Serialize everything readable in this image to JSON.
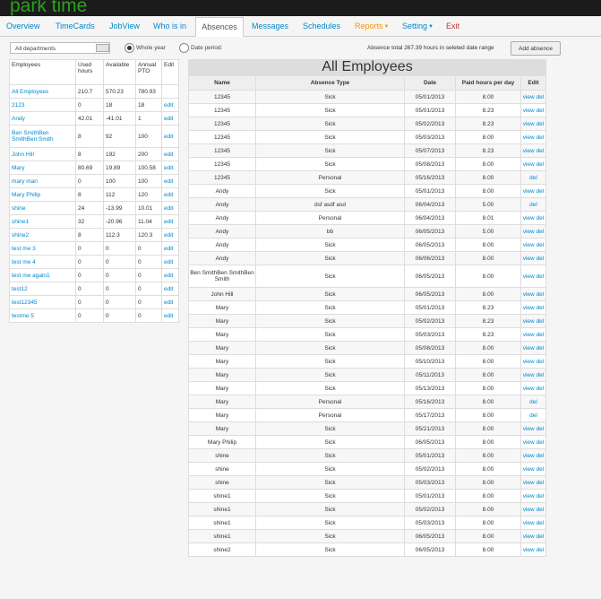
{
  "app": {
    "title": "park time"
  },
  "nav": {
    "overview": "Overview",
    "timecards": "TimeCards",
    "jobview": "JobView",
    "whoisin": "Who is in",
    "absences": "Absences",
    "messages": "Messages",
    "schedules": "Schedules",
    "reports": "Reports",
    "setting": "Setting",
    "exit": "Exit"
  },
  "filters": {
    "department": "All departments",
    "whole_year_label": "Whole year",
    "date_period_label": "Date period:",
    "selected": "Whole year"
  },
  "summary": {
    "total_text": "Absence total 267.39 hours in seleted date range",
    "add_button": "Add absence"
  },
  "left_table": {
    "headers": [
      "Employees",
      "Used hours",
      "Available",
      "Annual PTO",
      "Edit"
    ],
    "rows": [
      {
        "name": "All Employees",
        "used": "210.7",
        "available": "570.23",
        "annual": "780.93",
        "edit": ""
      },
      {
        "name": "2123",
        "used": "0",
        "available": "18",
        "annual": "18",
        "edit": "edit"
      },
      {
        "name": "Andy",
        "used": "42.01",
        "available": "-41.01",
        "annual": "1",
        "edit": "edit"
      },
      {
        "name": "Ben SmithBen SmithBen Smith",
        "used": "8",
        "available": "92",
        "annual": "100",
        "edit": "edit"
      },
      {
        "name": "John Hill",
        "used": "8",
        "available": "192",
        "annual": "200",
        "edit": "edit"
      },
      {
        "name": "Mary",
        "used": "80.69",
        "available": "19.89",
        "annual": "100.58",
        "edit": "edit"
      },
      {
        "name": "mary man",
        "used": "0",
        "available": "100",
        "annual": "100",
        "edit": "edit"
      },
      {
        "name": "Mary Philip",
        "used": "8",
        "available": "112",
        "annual": "120",
        "edit": "edit"
      },
      {
        "name": "shine",
        "used": "24",
        "available": "-13.99",
        "annual": "10.01",
        "edit": "edit"
      },
      {
        "name": "shine1",
        "used": "32",
        "available": "-20.96",
        "annual": "11.04",
        "edit": "edit"
      },
      {
        "name": "shine2",
        "used": "8",
        "available": "112.3",
        "annual": "120.3",
        "edit": "edit"
      },
      {
        "name": "test me 3",
        "used": "0",
        "available": "0",
        "annual": "0",
        "edit": "edit"
      },
      {
        "name": "test me 4",
        "used": "0",
        "available": "0",
        "annual": "0",
        "edit": "edit"
      },
      {
        "name": "test me again1",
        "used": "0",
        "available": "0",
        "annual": "0",
        "edit": "edit"
      },
      {
        "name": "test12",
        "used": "0",
        "available": "0",
        "annual": "0",
        "edit": "edit"
      },
      {
        "name": "test12345",
        "used": "0",
        "available": "0",
        "annual": "0",
        "edit": "edit"
      },
      {
        "name": "testme 5",
        "used": "0",
        "available": "0",
        "annual": "0",
        "edit": "edit"
      }
    ]
  },
  "main_table": {
    "title": "All Employees",
    "headers": [
      "Name",
      "Absence Type",
      "Date",
      "Paid hours per day",
      "Edit"
    ],
    "rows": [
      {
        "name": "12345",
        "type": "Sick",
        "date": "05/01/2013",
        "hours": "8.00",
        "view": "view",
        "del": "del"
      },
      {
        "name": "12345",
        "type": "Sick",
        "date": "05/01/2013",
        "hours": "8.23",
        "view": "view",
        "del": "del"
      },
      {
        "name": "12345",
        "type": "Sick",
        "date": "05/02/2013",
        "hours": "8.23",
        "view": "view",
        "del": "del"
      },
      {
        "name": "12345",
        "type": "Sick",
        "date": "05/03/2013",
        "hours": "8.00",
        "view": "view",
        "del": "del"
      },
      {
        "name": "12345",
        "type": "Sick",
        "date": "05/07/2013",
        "hours": "8.23",
        "view": "view",
        "del": "del"
      },
      {
        "name": "12345",
        "type": "Sick",
        "date": "05/08/2013",
        "hours": "8.00",
        "view": "view",
        "del": "del"
      },
      {
        "name": "12345",
        "type": "Personal",
        "date": "05/16/2013",
        "hours": "8.00",
        "view": "",
        "del": "del"
      },
      {
        "name": "Andy",
        "type": "Sick",
        "date": "05/01/2013",
        "hours": "8.00",
        "view": "view",
        "del": "del"
      },
      {
        "name": "Andy",
        "type": "dsf asdf asd",
        "date": "06/04/2013",
        "hours": "5.00",
        "view": "",
        "del": "del"
      },
      {
        "name": "Andy",
        "type": "Personal",
        "date": "06/04/2013",
        "hours": "8.01",
        "view": "view",
        "del": "del"
      },
      {
        "name": "Andy",
        "type": "bb",
        "date": "06/05/2013",
        "hours": "5.00",
        "view": "view",
        "del": "del"
      },
      {
        "name": "Andy",
        "type": "Sick",
        "date": "06/05/2013",
        "hours": "8.00",
        "view": "view",
        "del": "del"
      },
      {
        "name": "Andy",
        "type": "Sick",
        "date": "06/06/2013",
        "hours": "8.00",
        "view": "view",
        "del": "del"
      },
      {
        "name": "Ben SmithBen SmithBen Smith",
        "type": "Sick",
        "date": "06/05/2013",
        "hours": "8.00",
        "view": "view",
        "del": "del"
      },
      {
        "name": "John Hill",
        "type": "Sick",
        "date": "06/05/2013",
        "hours": "8.00",
        "view": "view",
        "del": "del"
      },
      {
        "name": "Mary",
        "type": "Sick",
        "date": "05/01/2013",
        "hours": "8.23",
        "view": "view",
        "del": "del"
      },
      {
        "name": "Mary",
        "type": "Sick",
        "date": "05/02/2013",
        "hours": "8.23",
        "view": "view",
        "del": "del"
      },
      {
        "name": "Mary",
        "type": "Sick",
        "date": "05/03/2013",
        "hours": "8.23",
        "view": "view",
        "del": "del"
      },
      {
        "name": "Mary",
        "type": "Sick",
        "date": "05/08/2013",
        "hours": "8.00",
        "view": "view",
        "del": "del"
      },
      {
        "name": "Mary",
        "type": "Sick",
        "date": "05/10/2013",
        "hours": "8.00",
        "view": "view",
        "del": "del"
      },
      {
        "name": "Mary",
        "type": "Sick",
        "date": "05/11/2013",
        "hours": "8.00",
        "view": "view",
        "del": "del"
      },
      {
        "name": "Mary",
        "type": "Sick",
        "date": "05/13/2013",
        "hours": "8.00",
        "view": "view",
        "del": "del"
      },
      {
        "name": "Mary",
        "type": "Personal",
        "date": "05/16/2013",
        "hours": "8.00",
        "view": "",
        "del": "del"
      },
      {
        "name": "Mary",
        "type": "Personal",
        "date": "05/17/2013",
        "hours": "8.00",
        "view": "",
        "del": "del"
      },
      {
        "name": "Mary",
        "type": "Sick",
        "date": "05/21/2013",
        "hours": "8.00",
        "view": "view",
        "del": "del"
      },
      {
        "name": "Mary Philip",
        "type": "Sick",
        "date": "06/05/2013",
        "hours": "8.00",
        "view": "view",
        "del": "del"
      },
      {
        "name": "shine",
        "type": "Sick",
        "date": "05/01/2013",
        "hours": "8.00",
        "view": "view",
        "del": "del"
      },
      {
        "name": "shine",
        "type": "Sick",
        "date": "05/02/2013",
        "hours": "8.00",
        "view": "view",
        "del": "del"
      },
      {
        "name": "shine",
        "type": "Sick",
        "date": "05/03/2013",
        "hours": "8.00",
        "view": "view",
        "del": "del"
      },
      {
        "name": "shine1",
        "type": "Sick",
        "date": "05/01/2013",
        "hours": "8.00",
        "view": "view",
        "del": "del"
      },
      {
        "name": "shine1",
        "type": "Sick",
        "date": "05/02/2013",
        "hours": "8.00",
        "view": "view",
        "del": "del"
      },
      {
        "name": "shine1",
        "type": "Sick",
        "date": "05/03/2013",
        "hours": "8.00",
        "view": "view",
        "del": "del"
      },
      {
        "name": "shine1",
        "type": "Sick",
        "date": "06/05/2013",
        "hours": "8.00",
        "view": "view",
        "del": "del"
      },
      {
        "name": "shine2",
        "type": "Sick",
        "date": "06/05/2013",
        "hours": "8.00",
        "view": "view",
        "del": "del"
      }
    ]
  }
}
